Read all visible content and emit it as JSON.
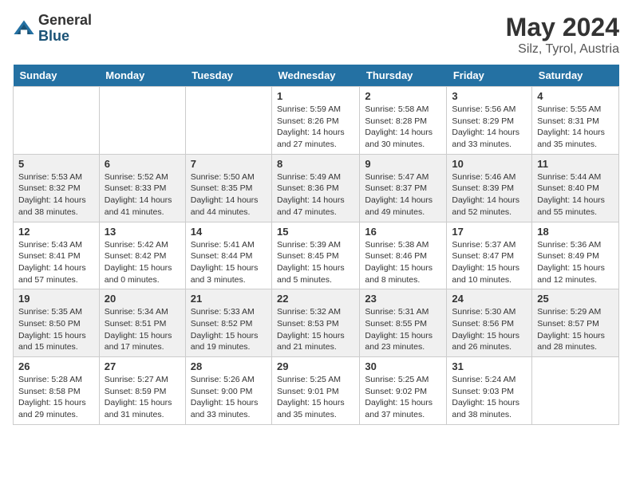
{
  "header": {
    "logo": {
      "general": "General",
      "blue": "Blue"
    },
    "title": "May 2024",
    "location": "Silz, Tyrol, Austria"
  },
  "weekdays": [
    "Sunday",
    "Monday",
    "Tuesday",
    "Wednesday",
    "Thursday",
    "Friday",
    "Saturday"
  ],
  "weeks": [
    [
      {
        "day": "",
        "info": ""
      },
      {
        "day": "",
        "info": ""
      },
      {
        "day": "",
        "info": ""
      },
      {
        "day": "1",
        "info": "Sunrise: 5:59 AM\nSunset: 8:26 PM\nDaylight: 14 hours and 27 minutes."
      },
      {
        "day": "2",
        "info": "Sunrise: 5:58 AM\nSunset: 8:28 PM\nDaylight: 14 hours and 30 minutes."
      },
      {
        "day": "3",
        "info": "Sunrise: 5:56 AM\nSunset: 8:29 PM\nDaylight: 14 hours and 33 minutes."
      },
      {
        "day": "4",
        "info": "Sunrise: 5:55 AM\nSunset: 8:31 PM\nDaylight: 14 hours and 35 minutes."
      }
    ],
    [
      {
        "day": "5",
        "info": "Sunrise: 5:53 AM\nSunset: 8:32 PM\nDaylight: 14 hours and 38 minutes."
      },
      {
        "day": "6",
        "info": "Sunrise: 5:52 AM\nSunset: 8:33 PM\nDaylight: 14 hours and 41 minutes."
      },
      {
        "day": "7",
        "info": "Sunrise: 5:50 AM\nSunset: 8:35 PM\nDaylight: 14 hours and 44 minutes."
      },
      {
        "day": "8",
        "info": "Sunrise: 5:49 AM\nSunset: 8:36 PM\nDaylight: 14 hours and 47 minutes."
      },
      {
        "day": "9",
        "info": "Sunrise: 5:47 AM\nSunset: 8:37 PM\nDaylight: 14 hours and 49 minutes."
      },
      {
        "day": "10",
        "info": "Sunrise: 5:46 AM\nSunset: 8:39 PM\nDaylight: 14 hours and 52 minutes."
      },
      {
        "day": "11",
        "info": "Sunrise: 5:44 AM\nSunset: 8:40 PM\nDaylight: 14 hours and 55 minutes."
      }
    ],
    [
      {
        "day": "12",
        "info": "Sunrise: 5:43 AM\nSunset: 8:41 PM\nDaylight: 14 hours and 57 minutes."
      },
      {
        "day": "13",
        "info": "Sunrise: 5:42 AM\nSunset: 8:42 PM\nDaylight: 15 hours and 0 minutes."
      },
      {
        "day": "14",
        "info": "Sunrise: 5:41 AM\nSunset: 8:44 PM\nDaylight: 15 hours and 3 minutes."
      },
      {
        "day": "15",
        "info": "Sunrise: 5:39 AM\nSunset: 8:45 PM\nDaylight: 15 hours and 5 minutes."
      },
      {
        "day": "16",
        "info": "Sunrise: 5:38 AM\nSunset: 8:46 PM\nDaylight: 15 hours and 8 minutes."
      },
      {
        "day": "17",
        "info": "Sunrise: 5:37 AM\nSunset: 8:47 PM\nDaylight: 15 hours and 10 minutes."
      },
      {
        "day": "18",
        "info": "Sunrise: 5:36 AM\nSunset: 8:49 PM\nDaylight: 15 hours and 12 minutes."
      }
    ],
    [
      {
        "day": "19",
        "info": "Sunrise: 5:35 AM\nSunset: 8:50 PM\nDaylight: 15 hours and 15 minutes."
      },
      {
        "day": "20",
        "info": "Sunrise: 5:34 AM\nSunset: 8:51 PM\nDaylight: 15 hours and 17 minutes."
      },
      {
        "day": "21",
        "info": "Sunrise: 5:33 AM\nSunset: 8:52 PM\nDaylight: 15 hours and 19 minutes."
      },
      {
        "day": "22",
        "info": "Sunrise: 5:32 AM\nSunset: 8:53 PM\nDaylight: 15 hours and 21 minutes."
      },
      {
        "day": "23",
        "info": "Sunrise: 5:31 AM\nSunset: 8:55 PM\nDaylight: 15 hours and 23 minutes."
      },
      {
        "day": "24",
        "info": "Sunrise: 5:30 AM\nSunset: 8:56 PM\nDaylight: 15 hours and 26 minutes."
      },
      {
        "day": "25",
        "info": "Sunrise: 5:29 AM\nSunset: 8:57 PM\nDaylight: 15 hours and 28 minutes."
      }
    ],
    [
      {
        "day": "26",
        "info": "Sunrise: 5:28 AM\nSunset: 8:58 PM\nDaylight: 15 hours and 29 minutes."
      },
      {
        "day": "27",
        "info": "Sunrise: 5:27 AM\nSunset: 8:59 PM\nDaylight: 15 hours and 31 minutes."
      },
      {
        "day": "28",
        "info": "Sunrise: 5:26 AM\nSunset: 9:00 PM\nDaylight: 15 hours and 33 minutes."
      },
      {
        "day": "29",
        "info": "Sunrise: 5:25 AM\nSunset: 9:01 PM\nDaylight: 15 hours and 35 minutes."
      },
      {
        "day": "30",
        "info": "Sunrise: 5:25 AM\nSunset: 9:02 PM\nDaylight: 15 hours and 37 minutes."
      },
      {
        "day": "31",
        "info": "Sunrise: 5:24 AM\nSunset: 9:03 PM\nDaylight: 15 hours and 38 minutes."
      },
      {
        "day": "",
        "info": ""
      }
    ]
  ]
}
